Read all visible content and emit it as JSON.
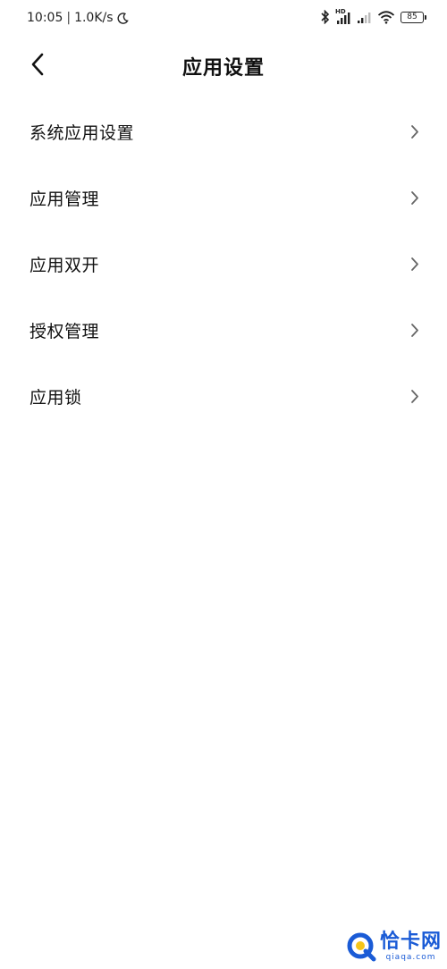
{
  "status_bar": {
    "time": "10:05",
    "separator": "|",
    "net_speed": "1.0K/s",
    "battery_level": "85",
    "hd_label": "HD",
    "icons": [
      "moon-icon",
      "bluetooth-icon",
      "signal-icon",
      "signal-weak-icon",
      "wifi-icon",
      "battery-icon"
    ]
  },
  "header": {
    "title": "应用设置",
    "back_icon": "chevron-left-icon"
  },
  "settings": {
    "items": [
      {
        "label": "系统应用设置"
      },
      {
        "label": "应用管理"
      },
      {
        "label": "应用双开"
      },
      {
        "label": "授权管理"
      },
      {
        "label": "应用锁"
      }
    ]
  },
  "watermark": {
    "title": "恰卡网",
    "url": "qiaqa.com",
    "color": "#1a5bd6"
  }
}
